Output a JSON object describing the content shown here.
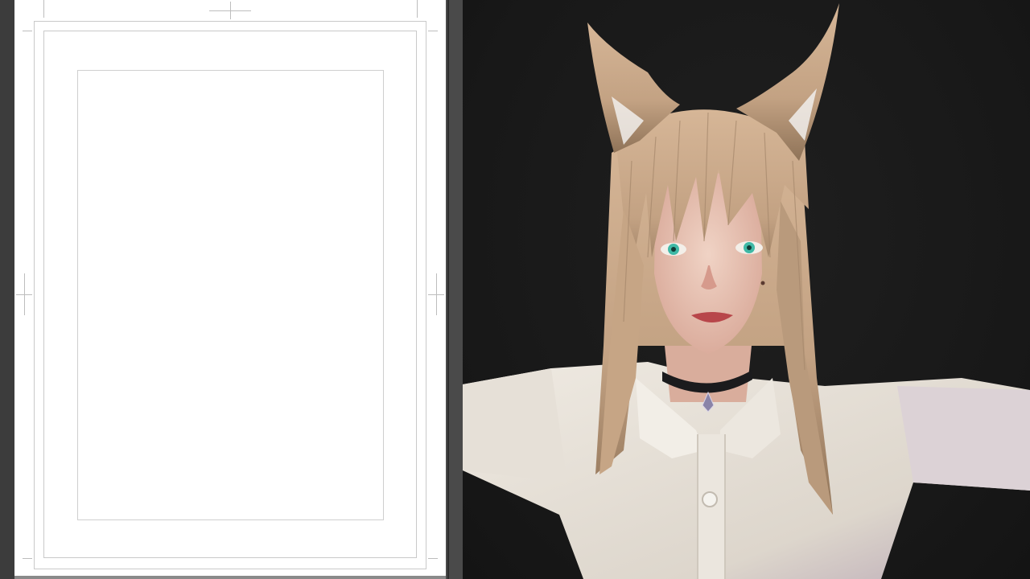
{
  "workspace": {
    "page": {
      "background": "#ffffff",
      "guide_color": "#c9c9c9"
    },
    "viewport": {
      "background": "#1a1a1a",
      "subject": "character-render",
      "colors": {
        "hair": "#c9a98a",
        "hair_shadow": "#8f7358",
        "skin": "#e8c7b8",
        "eyes": "#3fb9a6",
        "lips": "#b8464a",
        "shirt": "#e9e4dc",
        "choker": "#1b1b1d",
        "pendant": "#8a84a8"
      }
    }
  }
}
